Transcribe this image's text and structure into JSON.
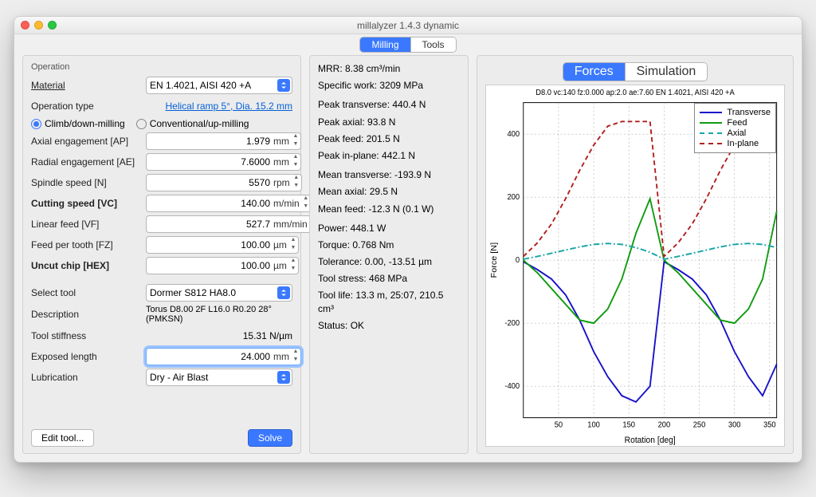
{
  "window_title": "millalyzer 1.4.3 dynamic",
  "main_tabs": {
    "milling": "Milling",
    "tools": "Tools",
    "active": "milling"
  },
  "operation": {
    "heading": "Operation",
    "material_label": "Material",
    "material_value": "EN 1.4021, AISI 420 +A",
    "op_type_label": "Operation type",
    "op_type_link": "Helical ramp 5°, Dia. 15.2 mm",
    "radio_climb": "Climb/down-milling",
    "radio_conv": "Conventional/up-milling",
    "fields": {
      "ap": {
        "label": "Axial engagement [AP]",
        "value": "1.979",
        "unit": "mm"
      },
      "ae": {
        "label": "Radial engagement [AE]",
        "value": "7.6000",
        "unit": "mm"
      },
      "n": {
        "label": "Spindle speed [N]",
        "value": "5570",
        "unit": "rpm"
      },
      "vc": {
        "label": "Cutting speed [VC]",
        "value": "140.00",
        "unit": "m/min",
        "bold": true
      },
      "vf": {
        "label": "Linear feed [VF]",
        "value": "527.7",
        "unit": "mm/min"
      },
      "fz": {
        "label": "Feed per tooth [FZ]",
        "value": "100.00",
        "unit": "µm"
      },
      "hex": {
        "label": "Uncut chip [HEX]",
        "value": "100.00",
        "unit": "µm",
        "bold": true
      }
    },
    "tool": {
      "select_label": "Select tool",
      "select_value": "Dormer S812 HA8.0",
      "desc_label": "Description",
      "desc_value": "Torus D8.00 2F L16.0 R0.20 28° (PMKSN)",
      "stiff_label": "Tool stiffness",
      "stiff_value": "15.31 N/µm",
      "exposed_label": "Exposed length",
      "exposed_value": "24.000",
      "exposed_unit": "mm",
      "lube_label": "Lubrication",
      "lube_value": "Dry - Air Blast"
    },
    "buttons": {
      "edit": "Edit tool...",
      "solve": "Solve"
    }
  },
  "results": {
    "mrr": "MRR: 8.38 cm³/min",
    "spec_work": "Specific work: 3209 MPa",
    "peak_transverse": "Peak transverse: 440.4 N",
    "peak_axial": "Peak axial: 93.8 N",
    "peak_feed": "Peak feed: 201.5 N",
    "peak_inplane": "Peak in-plane: 442.1 N",
    "mean_transverse": "Mean transverse: -193.9 N",
    "mean_axial": "Mean axial: 29.5 N",
    "mean_feed": "Mean feed: -12.3 N (0.1 W)",
    "power": "Power: 448.1 W",
    "torque": "Torque: 0.768 Nm",
    "tolerance": "Tolerance: 0.00, -13.51 µm",
    "stress": "Tool stress: 468 MPa",
    "life": "Tool life: 13.3 m, 25:07, 210.5 cm³",
    "status": "Status: OK"
  },
  "plot_tabs": {
    "forces": "Forces",
    "simulation": "Simulation",
    "active": "forces"
  },
  "chart_data": {
    "type": "line",
    "title": "D8.0 vc:140 fz:0.000 ap:2.0 ae:7.60 EN 1.4021, AISI 420 +A",
    "xlabel": "Rotation [deg]",
    "ylabel": "Force [N]",
    "xlim": [
      0,
      360
    ],
    "ylim": [
      -500,
      500
    ],
    "xticks": [
      50,
      100,
      150,
      200,
      250,
      300,
      350
    ],
    "yticks": [
      -400,
      -200,
      0,
      200,
      400
    ],
    "legend_position": "top-right",
    "series": [
      {
        "name": "Transverse",
        "color": "#1810c9",
        "dash": "solid",
        "x": [
          0,
          20,
          40,
          60,
          80,
          100,
          120,
          140,
          160,
          180,
          200,
          220,
          240,
          260,
          280,
          300,
          320,
          340,
          360
        ],
        "y": [
          -5,
          -30,
          -60,
          -110,
          -190,
          -290,
          -370,
          -430,
          -450,
          -400,
          -5,
          -30,
          -60,
          -110,
          -190,
          -290,
          -370,
          -430,
          -330
        ]
      },
      {
        "name": "Feed",
        "color": "#0f9b0f",
        "dash": "solid",
        "x": [
          0,
          20,
          40,
          60,
          80,
          100,
          120,
          140,
          160,
          180,
          200,
          220,
          240,
          260,
          280,
          300,
          320,
          340,
          360
        ],
        "y": [
          0,
          -40,
          -90,
          -140,
          -190,
          -200,
          -155,
          -60,
          85,
          195,
          0,
          -40,
          -90,
          -140,
          -190,
          -200,
          -155,
          -60,
          155
        ]
      },
      {
        "name": "Axial",
        "color": "#1aa6a6",
        "dash": "dashdot",
        "x": [
          0,
          20,
          40,
          60,
          80,
          100,
          120,
          140,
          160,
          180,
          200,
          220,
          240,
          260,
          280,
          300,
          320,
          340,
          360
        ],
        "y": [
          3,
          12,
          22,
          32,
          42,
          50,
          53,
          50,
          40,
          25,
          3,
          12,
          22,
          32,
          42,
          50,
          53,
          50,
          40
        ]
      },
      {
        "name": "In-plane",
        "color": "#b21e1e",
        "dash": "dashed",
        "x": [
          0,
          20,
          40,
          60,
          80,
          100,
          120,
          140,
          160,
          180,
          200,
          220,
          240,
          260,
          280,
          300,
          320,
          340,
          360
        ],
        "y": [
          12,
          55,
          115,
          195,
          285,
          365,
          425,
          440,
          440,
          440,
          12,
          55,
          115,
          195,
          285,
          365,
          425,
          440,
          370
        ]
      }
    ]
  }
}
